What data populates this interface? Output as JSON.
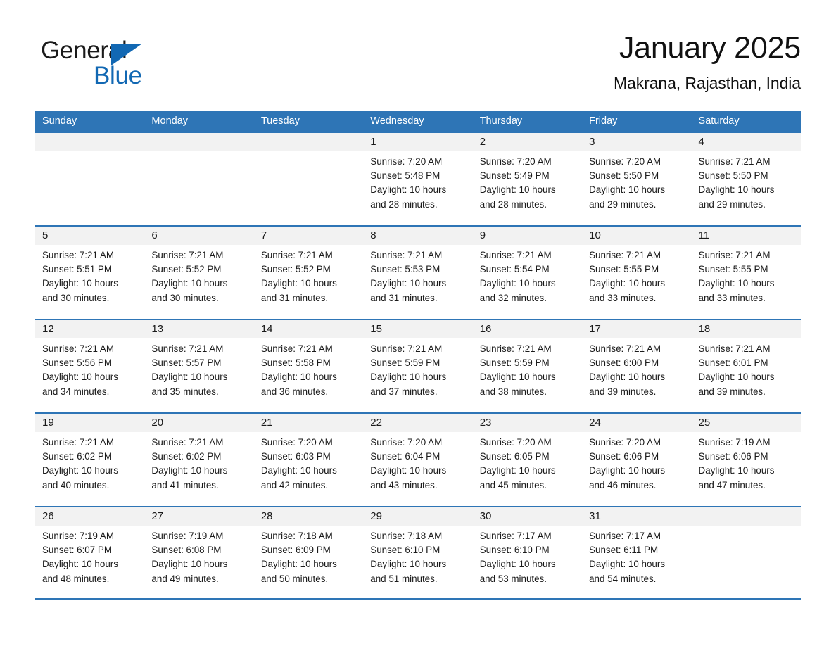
{
  "brand": {
    "name_primary": "General",
    "name_secondary": "Blue",
    "accent_color": "#1268B3"
  },
  "header": {
    "month_title": "January 2025",
    "location": "Makrana, Rajasthan, India"
  },
  "theme": {
    "header_bar_color": "#2E75B6",
    "day_band_color": "#F2F2F2",
    "text_color": "#1a1a1a"
  },
  "weekdays": [
    "Sunday",
    "Monday",
    "Tuesday",
    "Wednesday",
    "Thursday",
    "Friday",
    "Saturday"
  ],
  "weeks": [
    [
      {
        "day": "",
        "empty": true,
        "sunrise": "",
        "sunset": "",
        "daylight_line1": "",
        "daylight_line2": ""
      },
      {
        "day": "",
        "empty": true,
        "sunrise": "",
        "sunset": "",
        "daylight_line1": "",
        "daylight_line2": ""
      },
      {
        "day": "",
        "empty": true,
        "sunrise": "",
        "sunset": "",
        "daylight_line1": "",
        "daylight_line2": ""
      },
      {
        "day": "1",
        "empty": false,
        "sunrise": "Sunrise: 7:20 AM",
        "sunset": "Sunset: 5:48 PM",
        "daylight_line1": "Daylight: 10 hours",
        "daylight_line2": "and 28 minutes."
      },
      {
        "day": "2",
        "empty": false,
        "sunrise": "Sunrise: 7:20 AM",
        "sunset": "Sunset: 5:49 PM",
        "daylight_line1": "Daylight: 10 hours",
        "daylight_line2": "and 28 minutes."
      },
      {
        "day": "3",
        "empty": false,
        "sunrise": "Sunrise: 7:20 AM",
        "sunset": "Sunset: 5:50 PM",
        "daylight_line1": "Daylight: 10 hours",
        "daylight_line2": "and 29 minutes."
      },
      {
        "day": "4",
        "empty": false,
        "sunrise": "Sunrise: 7:21 AM",
        "sunset": "Sunset: 5:50 PM",
        "daylight_line1": "Daylight: 10 hours",
        "daylight_line2": "and 29 minutes."
      }
    ],
    [
      {
        "day": "5",
        "empty": false,
        "sunrise": "Sunrise: 7:21 AM",
        "sunset": "Sunset: 5:51 PM",
        "daylight_line1": "Daylight: 10 hours",
        "daylight_line2": "and 30 minutes."
      },
      {
        "day": "6",
        "empty": false,
        "sunrise": "Sunrise: 7:21 AM",
        "sunset": "Sunset: 5:52 PM",
        "daylight_line1": "Daylight: 10 hours",
        "daylight_line2": "and 30 minutes."
      },
      {
        "day": "7",
        "empty": false,
        "sunrise": "Sunrise: 7:21 AM",
        "sunset": "Sunset: 5:52 PM",
        "daylight_line1": "Daylight: 10 hours",
        "daylight_line2": "and 31 minutes."
      },
      {
        "day": "8",
        "empty": false,
        "sunrise": "Sunrise: 7:21 AM",
        "sunset": "Sunset: 5:53 PM",
        "daylight_line1": "Daylight: 10 hours",
        "daylight_line2": "and 31 minutes."
      },
      {
        "day": "9",
        "empty": false,
        "sunrise": "Sunrise: 7:21 AM",
        "sunset": "Sunset: 5:54 PM",
        "daylight_line1": "Daylight: 10 hours",
        "daylight_line2": "and 32 minutes."
      },
      {
        "day": "10",
        "empty": false,
        "sunrise": "Sunrise: 7:21 AM",
        "sunset": "Sunset: 5:55 PM",
        "daylight_line1": "Daylight: 10 hours",
        "daylight_line2": "and 33 minutes."
      },
      {
        "day": "11",
        "empty": false,
        "sunrise": "Sunrise: 7:21 AM",
        "sunset": "Sunset: 5:55 PM",
        "daylight_line1": "Daylight: 10 hours",
        "daylight_line2": "and 33 minutes."
      }
    ],
    [
      {
        "day": "12",
        "empty": false,
        "sunrise": "Sunrise: 7:21 AM",
        "sunset": "Sunset: 5:56 PM",
        "daylight_line1": "Daylight: 10 hours",
        "daylight_line2": "and 34 minutes."
      },
      {
        "day": "13",
        "empty": false,
        "sunrise": "Sunrise: 7:21 AM",
        "sunset": "Sunset: 5:57 PM",
        "daylight_line1": "Daylight: 10 hours",
        "daylight_line2": "and 35 minutes."
      },
      {
        "day": "14",
        "empty": false,
        "sunrise": "Sunrise: 7:21 AM",
        "sunset": "Sunset: 5:58 PM",
        "daylight_line1": "Daylight: 10 hours",
        "daylight_line2": "and 36 minutes."
      },
      {
        "day": "15",
        "empty": false,
        "sunrise": "Sunrise: 7:21 AM",
        "sunset": "Sunset: 5:59 PM",
        "daylight_line1": "Daylight: 10 hours",
        "daylight_line2": "and 37 minutes."
      },
      {
        "day": "16",
        "empty": false,
        "sunrise": "Sunrise: 7:21 AM",
        "sunset": "Sunset: 5:59 PM",
        "daylight_line1": "Daylight: 10 hours",
        "daylight_line2": "and 38 minutes."
      },
      {
        "day": "17",
        "empty": false,
        "sunrise": "Sunrise: 7:21 AM",
        "sunset": "Sunset: 6:00 PM",
        "daylight_line1": "Daylight: 10 hours",
        "daylight_line2": "and 39 minutes."
      },
      {
        "day": "18",
        "empty": false,
        "sunrise": "Sunrise: 7:21 AM",
        "sunset": "Sunset: 6:01 PM",
        "daylight_line1": "Daylight: 10 hours",
        "daylight_line2": "and 39 minutes."
      }
    ],
    [
      {
        "day": "19",
        "empty": false,
        "sunrise": "Sunrise: 7:21 AM",
        "sunset": "Sunset: 6:02 PM",
        "daylight_line1": "Daylight: 10 hours",
        "daylight_line2": "and 40 minutes."
      },
      {
        "day": "20",
        "empty": false,
        "sunrise": "Sunrise: 7:21 AM",
        "sunset": "Sunset: 6:02 PM",
        "daylight_line1": "Daylight: 10 hours",
        "daylight_line2": "and 41 minutes."
      },
      {
        "day": "21",
        "empty": false,
        "sunrise": "Sunrise: 7:20 AM",
        "sunset": "Sunset: 6:03 PM",
        "daylight_line1": "Daylight: 10 hours",
        "daylight_line2": "and 42 minutes."
      },
      {
        "day": "22",
        "empty": false,
        "sunrise": "Sunrise: 7:20 AM",
        "sunset": "Sunset: 6:04 PM",
        "daylight_line1": "Daylight: 10 hours",
        "daylight_line2": "and 43 minutes."
      },
      {
        "day": "23",
        "empty": false,
        "sunrise": "Sunrise: 7:20 AM",
        "sunset": "Sunset: 6:05 PM",
        "daylight_line1": "Daylight: 10 hours",
        "daylight_line2": "and 45 minutes."
      },
      {
        "day": "24",
        "empty": false,
        "sunrise": "Sunrise: 7:20 AM",
        "sunset": "Sunset: 6:06 PM",
        "daylight_line1": "Daylight: 10 hours",
        "daylight_line2": "and 46 minutes."
      },
      {
        "day": "25",
        "empty": false,
        "sunrise": "Sunrise: 7:19 AM",
        "sunset": "Sunset: 6:06 PM",
        "daylight_line1": "Daylight: 10 hours",
        "daylight_line2": "and 47 minutes."
      }
    ],
    [
      {
        "day": "26",
        "empty": false,
        "sunrise": "Sunrise: 7:19 AM",
        "sunset": "Sunset: 6:07 PM",
        "daylight_line1": "Daylight: 10 hours",
        "daylight_line2": "and 48 minutes."
      },
      {
        "day": "27",
        "empty": false,
        "sunrise": "Sunrise: 7:19 AM",
        "sunset": "Sunset: 6:08 PM",
        "daylight_line1": "Daylight: 10 hours",
        "daylight_line2": "and 49 minutes."
      },
      {
        "day": "28",
        "empty": false,
        "sunrise": "Sunrise: 7:18 AM",
        "sunset": "Sunset: 6:09 PM",
        "daylight_line1": "Daylight: 10 hours",
        "daylight_line2": "and 50 minutes."
      },
      {
        "day": "29",
        "empty": false,
        "sunrise": "Sunrise: 7:18 AM",
        "sunset": "Sunset: 6:10 PM",
        "daylight_line1": "Daylight: 10 hours",
        "daylight_line2": "and 51 minutes."
      },
      {
        "day": "30",
        "empty": false,
        "sunrise": "Sunrise: 7:17 AM",
        "sunset": "Sunset: 6:10 PM",
        "daylight_line1": "Daylight: 10 hours",
        "daylight_line2": "and 53 minutes."
      },
      {
        "day": "31",
        "empty": false,
        "sunrise": "Sunrise: 7:17 AM",
        "sunset": "Sunset: 6:11 PM",
        "daylight_line1": "Daylight: 10 hours",
        "daylight_line2": "and 54 minutes."
      },
      {
        "day": "",
        "empty": true,
        "sunrise": "",
        "sunset": "",
        "daylight_line1": "",
        "daylight_line2": ""
      }
    ]
  ]
}
